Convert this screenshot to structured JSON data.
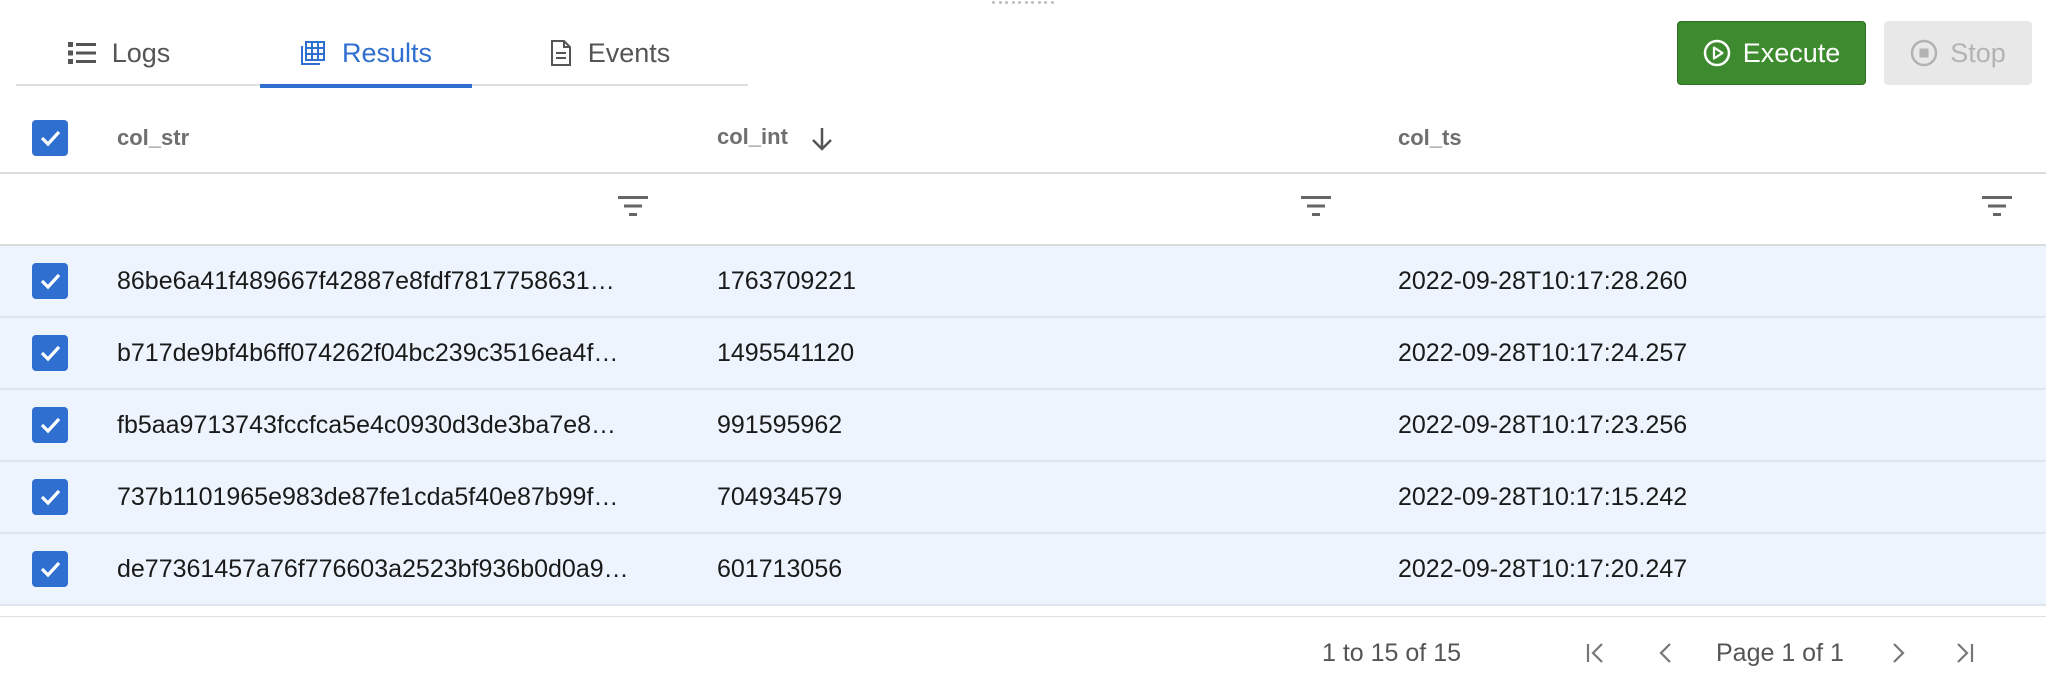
{
  "tabs": [
    {
      "label": "Logs",
      "icon": "list-icon"
    },
    {
      "label": "Results",
      "icon": "table-icon"
    },
    {
      "label": "Events",
      "icon": "document-icon"
    }
  ],
  "active_tab": "Results",
  "toolbar": {
    "execute_label": "Execute",
    "stop_label": "Stop"
  },
  "columns": [
    {
      "label": "col_str"
    },
    {
      "label": "col_int",
      "sort": "descending"
    },
    {
      "label": "col_ts"
    }
  ],
  "rows": [
    {
      "col_str": "86be6a41f489667f42887e8fdf7817758631…",
      "col_int": "1763709221",
      "col_ts": "2022-09-28T10:17:28.260",
      "checked": true
    },
    {
      "col_str": "b717de9bf4b6ff074262f04bc239c3516ea4f…",
      "col_int": "1495541120",
      "col_ts": "2022-09-28T10:17:24.257",
      "checked": true
    },
    {
      "col_str": "fb5aa9713743fccfca5e4c0930d3de3ba7e8…",
      "col_int": "991595962",
      "col_ts": "2022-09-28T10:17:23.256",
      "checked": true
    },
    {
      "col_str": "737b1101965e983de87fe1cda5f40e87b99f…",
      "col_int": "704934579",
      "col_ts": "2022-09-28T10:17:15.242",
      "checked": true
    },
    {
      "col_str": "de77361457a76f776603a2523bf936b0d0a9…",
      "col_int": "601713056",
      "col_ts": "2022-09-28T10:17:20.247",
      "checked": true
    }
  ],
  "pagination": {
    "range": "1 to 15 of 15",
    "page": "Page 1 of 1"
  },
  "colors": {
    "accent": "#2f6fd0",
    "execute": "#3d8b2e",
    "selected_row": "#edf4fd"
  }
}
